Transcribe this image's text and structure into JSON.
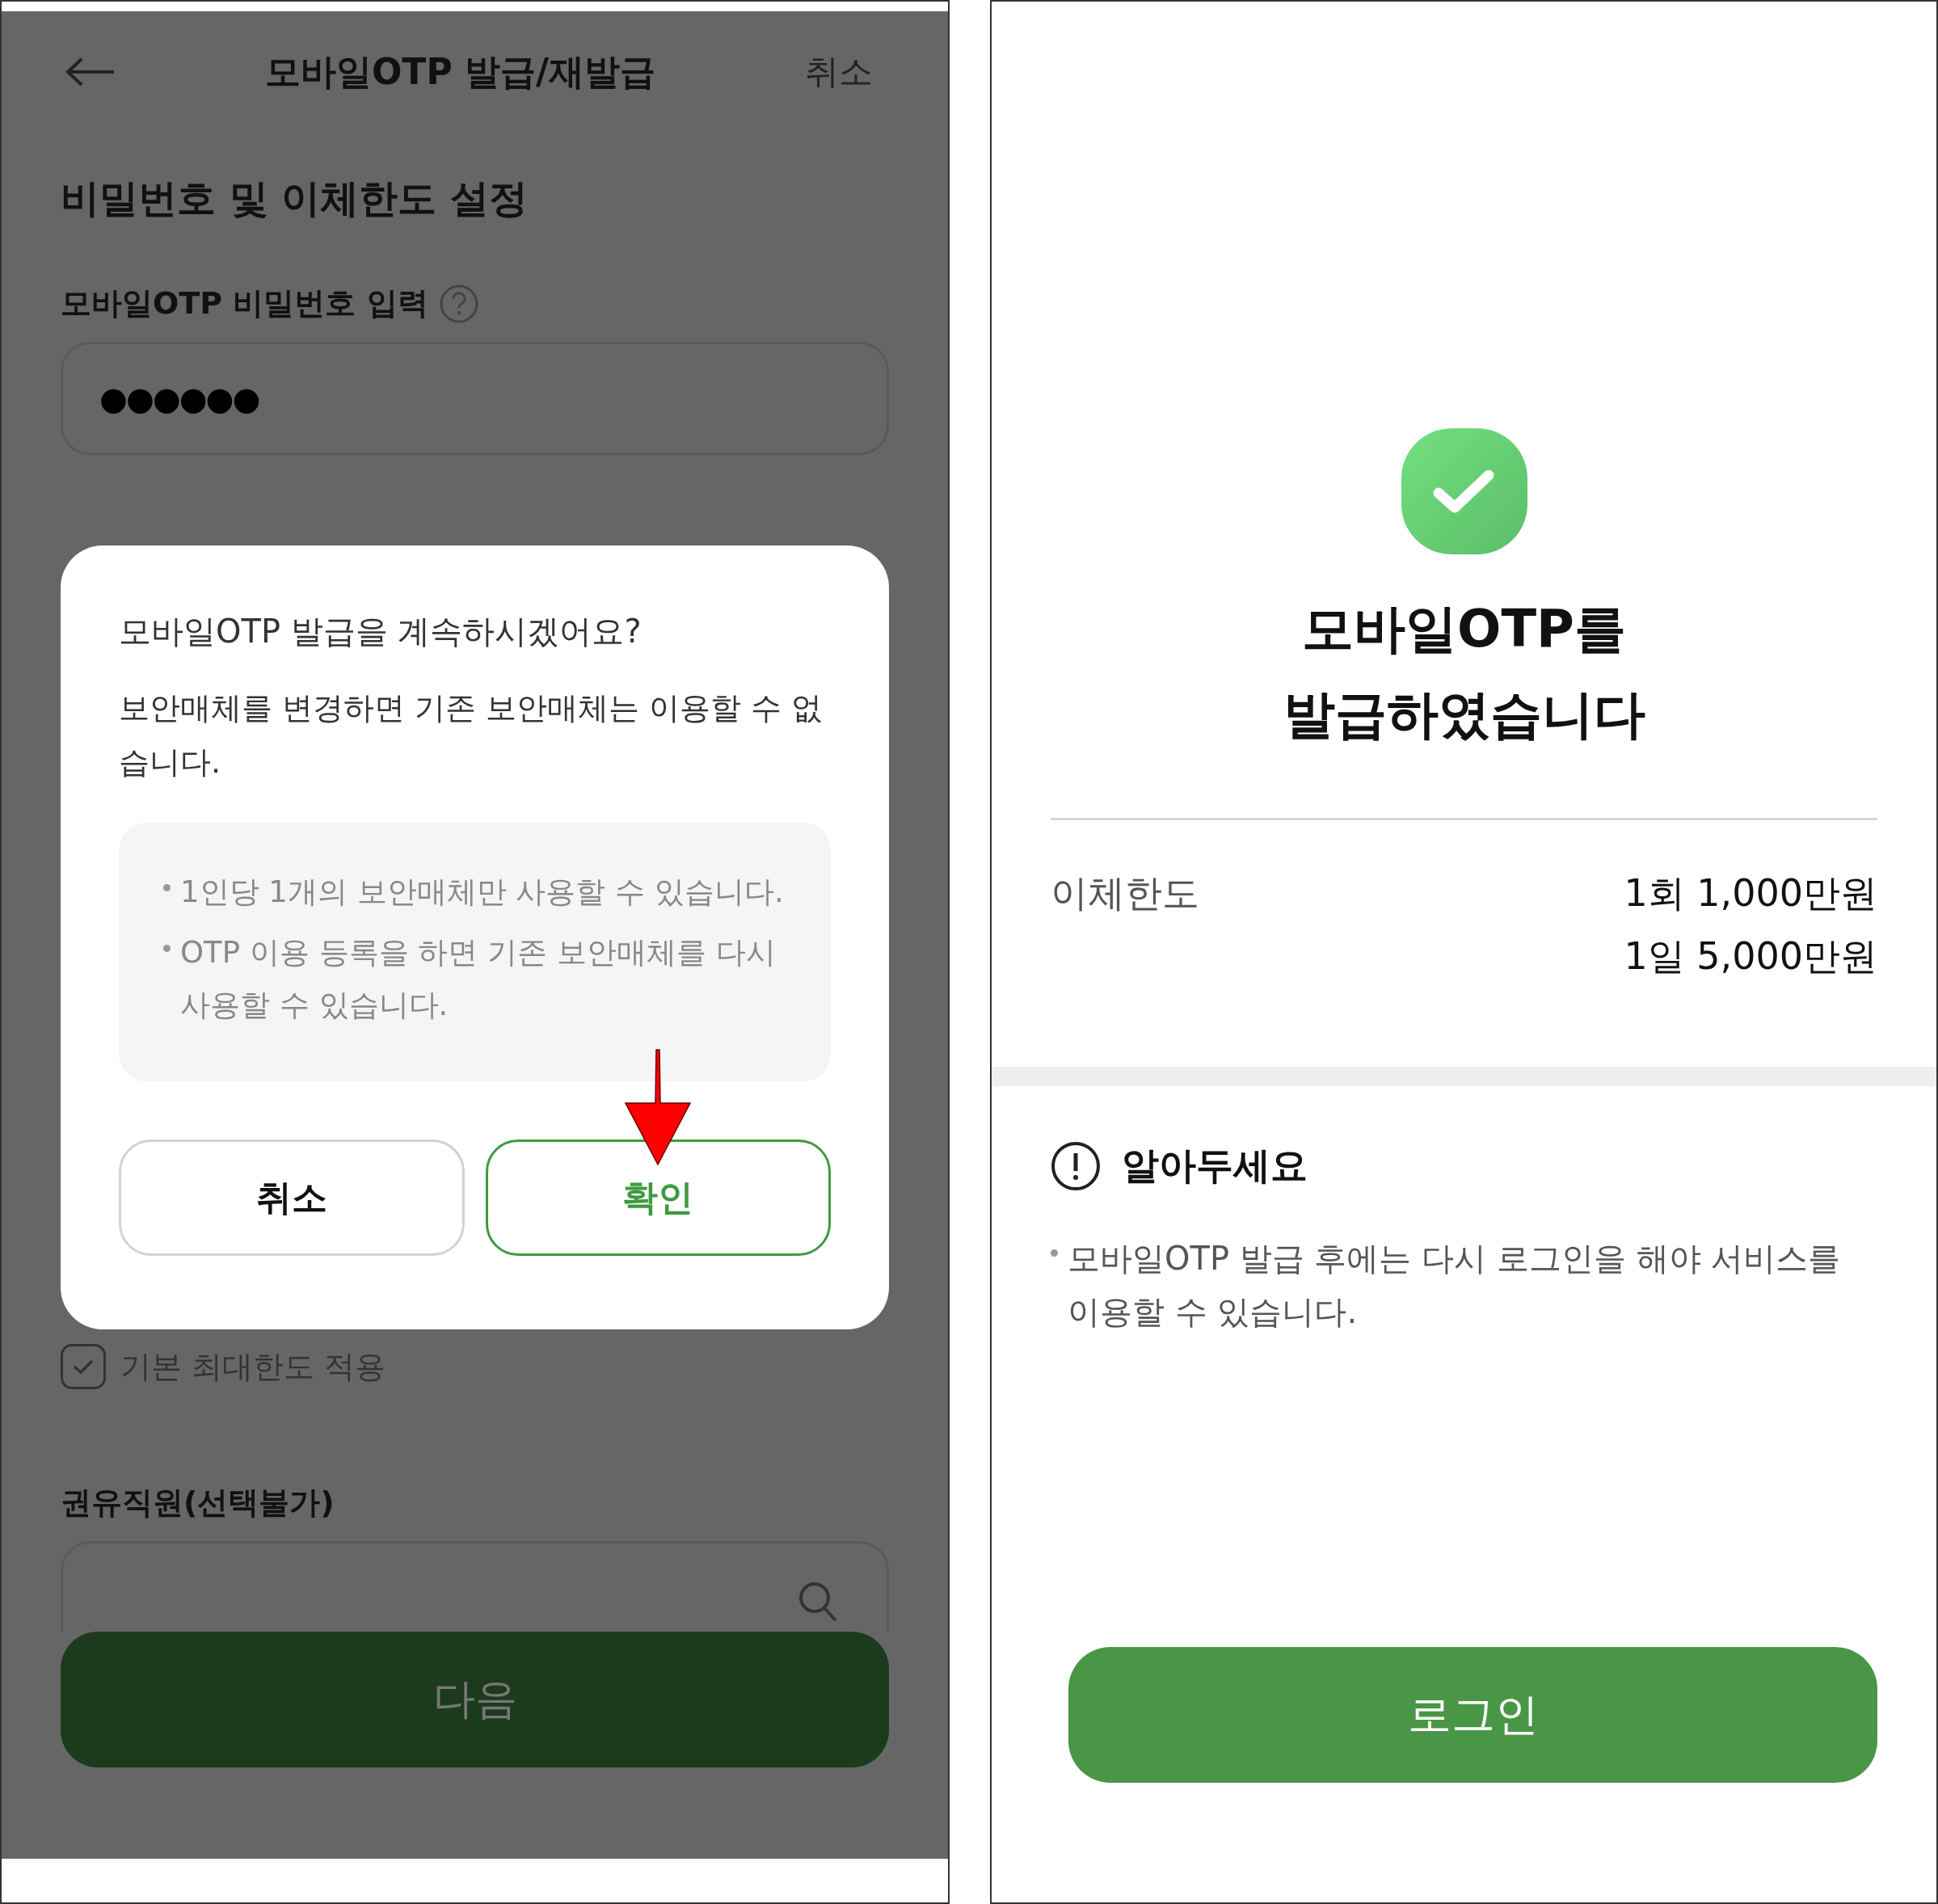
{
  "left_screen": {
    "header": {
      "title": "모바일OTP 발급/재발급",
      "cancel": "취소"
    },
    "section_title": "비밀번호 및 이체한도 설정",
    "password_label": "모바일OTP 비밀번호 입력",
    "password_field": {
      "value": "●●●●●●"
    },
    "checkbox": {
      "label": "기본 최대한도 적용",
      "checked": true
    },
    "recommender_label": "권유직원(선택불가)",
    "next_button": "다음"
  },
  "dialog": {
    "question": "모바일OTP 발급을 계속하시겠어요?",
    "message": "보안매체를 변경하면 기존 보안매체는 이용할 수 없습니다.",
    "notes": [
      "1인당 1개의 보안매체만 사용할 수 있습니다.",
      "OTP 이용 등록을 하면 기존 보안매체를 다시 사용할 수 있습니다."
    ],
    "buttons": [
      {
        "label": "취소",
        "kind": "secondary"
      },
      {
        "label": "확인",
        "kind": "primary"
      }
    ]
  },
  "right_screen": {
    "title_lines": [
      "모바일OTP를",
      "발급하였습니다"
    ],
    "limit": {
      "label": "이체한도",
      "values": [
        "1회 1,000만원",
        "1일 5,000만원"
      ]
    },
    "notice": {
      "title": "알아두세요",
      "items": [
        "모바일OTP 발급 후에는 다시 로그인을 해야 서비스를 이용할 수 있습니다."
      ]
    },
    "login_button": "로그인"
  }
}
